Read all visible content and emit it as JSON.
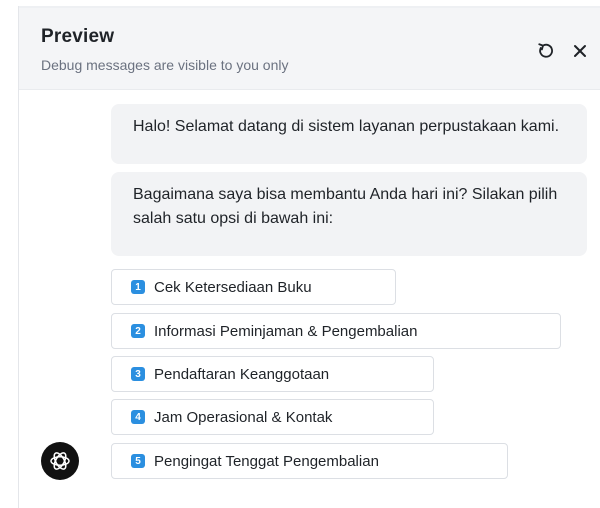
{
  "header": {
    "title": "Preview",
    "subtitle": "Debug messages are visible to you only",
    "refresh_icon": "refresh-icon",
    "close_icon": "close-icon"
  },
  "messages": [
    {
      "text": "Halo! Selamat datang di sistem layanan perpustakaan kami."
    },
    {
      "text": "Bagaimana saya bisa membantu Anda hari ini? Silakan pilih salah satu opsi di bawah ini:"
    }
  ],
  "options": [
    {
      "number": "1",
      "label": "Cek Ketersediaan Buku"
    },
    {
      "number": "2",
      "label": "Informasi Peminjaman & Pengembalian"
    },
    {
      "number": "3",
      "label": "Pendaftaran Keanggotaan"
    },
    {
      "number": "4",
      "label": "Jam Operasional & Kontak"
    },
    {
      "number": "5",
      "label": "Pengingat Tenggat Pengembalian"
    }
  ],
  "bot": {
    "avatar_icon": "openai-logo-icon"
  },
  "colors": {
    "header_bg": "#f4f5f7",
    "bubble_bg": "#f2f3f5",
    "option_badge": "#2b8fe0",
    "avatar_bg": "#111111"
  }
}
